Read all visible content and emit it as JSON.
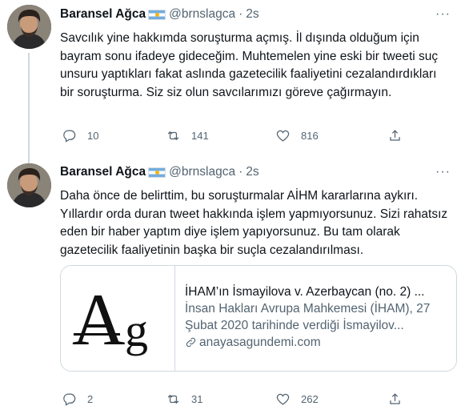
{
  "tweets": [
    {
      "name": "Baransel Ağca",
      "handle": "@brnslagca",
      "separator": "·",
      "time": "2s",
      "text": "Savcılık yine hakkımda soruşturma açmış. İl dışında olduğum için bayram sonu ifadeye gideceğim. Muhtemelen yine eski bir tweeti suç unsuru yaptıkları fakat aslında gazetecilik faaliyetini cezalandırdıkları bir soruşturma. Siz siz olun savcılarımızı göreve çağırmayın.",
      "replies": "10",
      "retweets": "141",
      "likes": "816"
    },
    {
      "name": "Baransel Ağca",
      "handle": "@brnslagca",
      "separator": "·",
      "time": "2s",
      "text": "Daha önce de belirttim, bu soruşturmalar AİHM kararlarına aykırı. Yıllardır orda duran tweet hakkında işlem yapmıyorsunuz. Sizi rahatsız eden bir haber yaptım diye işlem yapıyorsunuz. Bu tam olarak gazetecilik faaliyetinin başka bir suçla cezalandırılması.",
      "replies": "2",
      "retweets": "31",
      "likes": "262",
      "card": {
        "logo_text": "Ag",
        "title": "İHAM’ın İsmayilova v. Azerbaycan (no. 2) ...",
        "description": "İnsan Hakları Avrupa Mahkemesi (İHAM), 27 Şubat 2020 tarihinde verdiği İsmayilov...",
        "domain": "anayasagundemi.com"
      }
    }
  ],
  "colors": {
    "text": "#0f1419",
    "secondary": "#536471",
    "border": "#cfd9de",
    "flag_blue": "#74acdf",
    "flag_sun": "#f6b40e"
  },
  "icons": {
    "reply": "reply-icon",
    "retweet": "retweet-icon",
    "like": "heart-icon",
    "share": "share-icon",
    "more": "more-icon",
    "link": "link-icon",
    "flag": "argentina-flag-icon"
  }
}
